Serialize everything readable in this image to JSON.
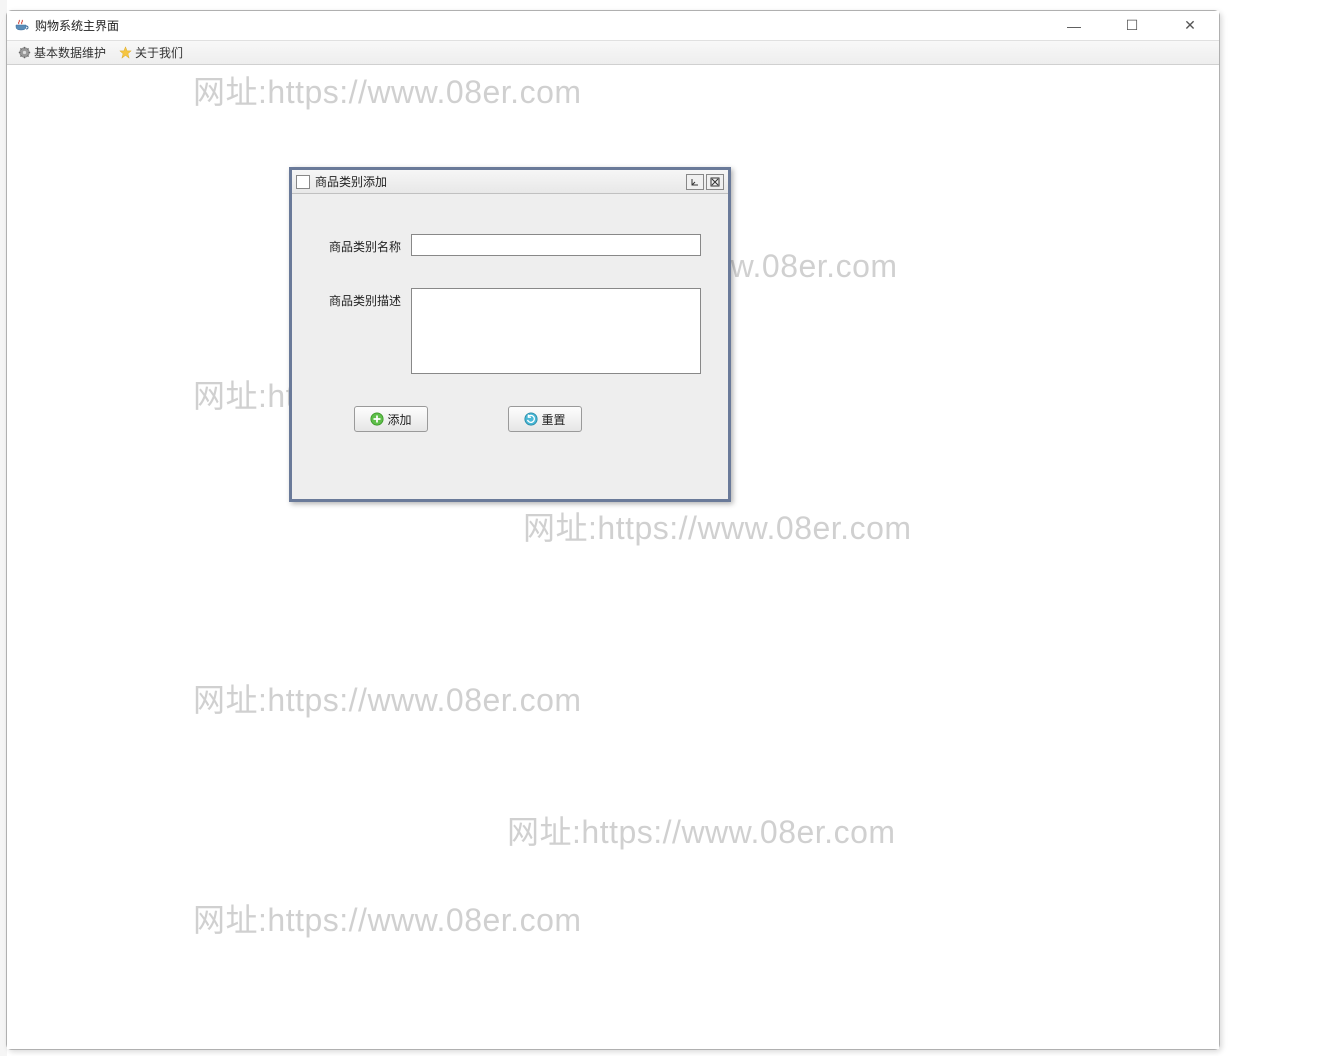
{
  "window": {
    "title": "购物系统主界面",
    "controls": {
      "minimize": "—",
      "maximize": "☐",
      "close": "✕"
    }
  },
  "menubar": {
    "items": [
      {
        "label": "基本数据维护",
        "icon": "gear-icon"
      },
      {
        "label": "关于我们",
        "icon": "star-icon"
      }
    ]
  },
  "internal_frame": {
    "title": "商品类别添加",
    "controls": {
      "minimize_internal": "↙",
      "close_internal": "⊠"
    },
    "form": {
      "name_label": "商品类别名称",
      "name_value": "",
      "desc_label": "商品类别描述",
      "desc_value": ""
    },
    "buttons": {
      "add_label": "添加",
      "reset_label": "重置"
    }
  },
  "watermark": {
    "text": "网址:https://www.08er.com"
  }
}
